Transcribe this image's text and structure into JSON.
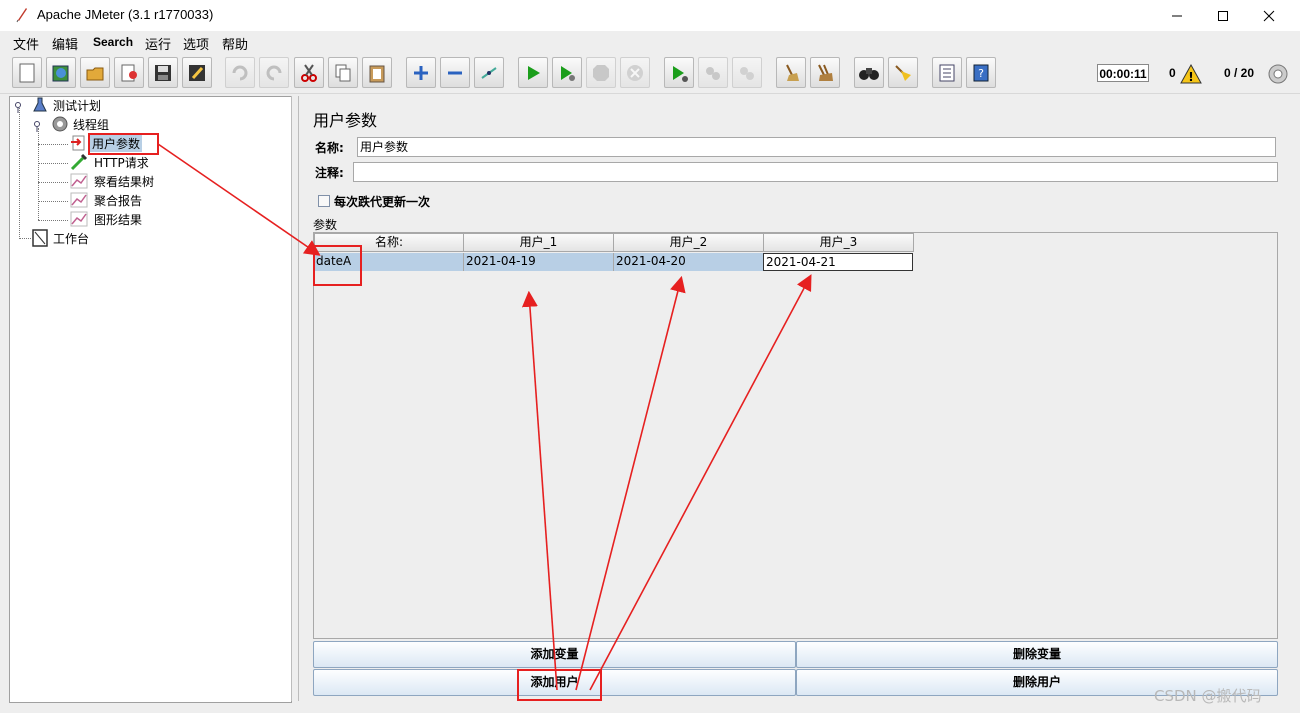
{
  "window": {
    "title": "Apache JMeter (3.1 r1770033)",
    "controls": [
      "minimize",
      "maximize",
      "close"
    ]
  },
  "menu": [
    "文件",
    "编辑",
    "Search",
    "运行",
    "选项",
    "帮助"
  ],
  "toolbar": {
    "buttons": [
      "new",
      "templates",
      "open",
      "close",
      "save",
      "save-as",
      "undo",
      "redo",
      "cut",
      "copy",
      "paste",
      "expand",
      "collapse",
      "toggle",
      "start",
      "start-no-pauses",
      "stop",
      "shutdown",
      "remote-start",
      "remote-stop",
      "remote-exit",
      "clear",
      "clear-all",
      "search",
      "reset-search",
      "function-helper",
      "help"
    ],
    "timer": "00:00:11",
    "error_count": "0",
    "threads": "0 / 20"
  },
  "tree": {
    "items": [
      {
        "label": "测试计划",
        "icon": "flask-icon"
      },
      {
        "label": "线程组",
        "icon": "gear-icon"
      },
      {
        "label": "用户参数",
        "icon": "preprocessor-icon"
      },
      {
        "label": "HTTP请求",
        "icon": "pipette-icon"
      },
      {
        "label": "察看结果树",
        "icon": "graph-icon"
      },
      {
        "label": "聚合报告",
        "icon": "graph-icon"
      },
      {
        "label": "图形结果",
        "icon": "graph-icon"
      },
      {
        "label": "工作台",
        "icon": "notebook-icon"
      }
    ]
  },
  "panel": {
    "title": "用户参数",
    "name_label": "名称:",
    "name_value": "用户参数",
    "comment_label": "注释:",
    "comment_value": "",
    "per_iteration_label": "每次跌代更新一次",
    "per_iteration_checked": false,
    "params_label": "参数",
    "table": {
      "headers": [
        "名称:",
        "用户_1",
        "用户_2",
        "用户_3"
      ],
      "rows": [
        [
          "dateA",
          "2021-04-19",
          "2021-04-20",
          "2021-04-21"
        ]
      ]
    },
    "buttons": {
      "add_variable": "添加变量",
      "delete_variable": "删除变量",
      "add_user": "添加用户",
      "delete_user": "删除用户"
    }
  },
  "watermark": "CSDN @搬代码",
  "annotation_color": "#e62020",
  "selection_color": "#b8cfe5"
}
